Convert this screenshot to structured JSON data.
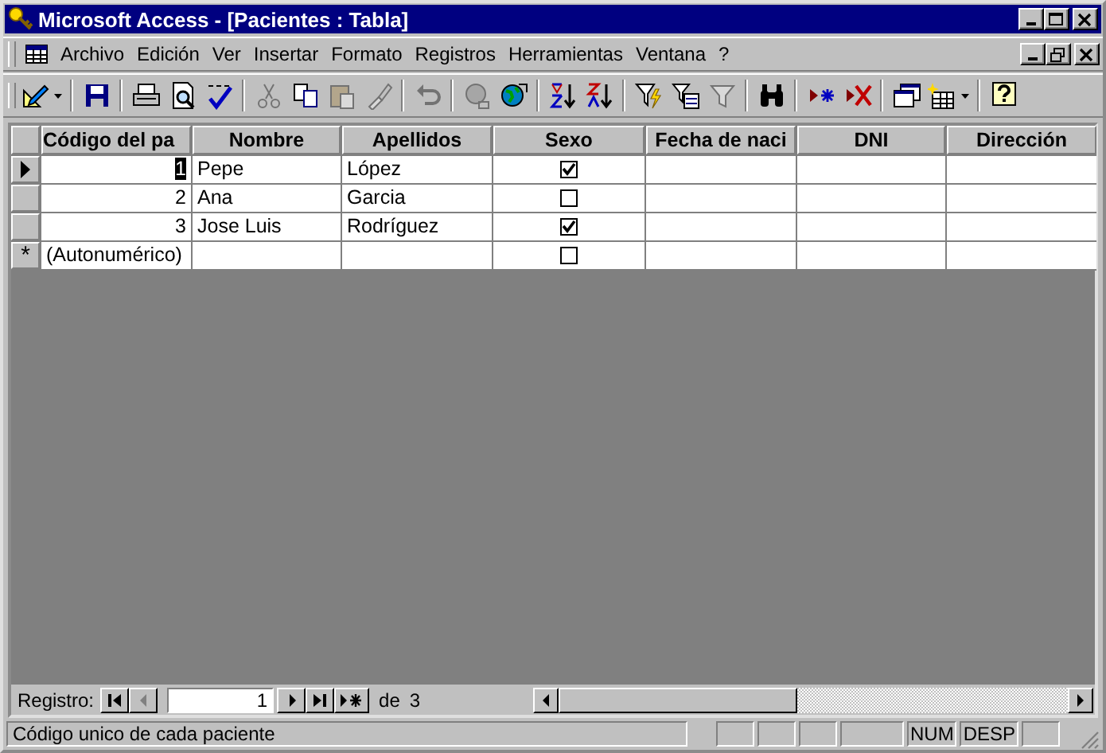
{
  "window": {
    "title": "Microsoft Access - [Pacientes : Tabla]"
  },
  "menu": [
    "Archivo",
    "Edición",
    "Ver",
    "Insertar",
    "Formato",
    "Registros",
    "Herramientas",
    "Ventana",
    "?"
  ],
  "toolbar": [
    {
      "kind": "design",
      "disabled": false,
      "dropdown": true
    },
    {
      "kind": "sep"
    },
    {
      "kind": "save",
      "disabled": false
    },
    {
      "kind": "sep"
    },
    {
      "kind": "print",
      "disabled": false
    },
    {
      "kind": "preview",
      "disabled": false
    },
    {
      "kind": "spelling",
      "disabled": false
    },
    {
      "kind": "sep"
    },
    {
      "kind": "cut",
      "disabled": true
    },
    {
      "kind": "copy",
      "disabled": false
    },
    {
      "kind": "paste",
      "disabled": true
    },
    {
      "kind": "brush",
      "disabled": true
    },
    {
      "kind": "sep"
    },
    {
      "kind": "undo",
      "disabled": true
    },
    {
      "kind": "sep"
    },
    {
      "kind": "globe-link",
      "disabled": true
    },
    {
      "kind": "globe",
      "disabled": false
    },
    {
      "kind": "sep"
    },
    {
      "kind": "sort-asc",
      "disabled": false
    },
    {
      "kind": "sort-desc",
      "disabled": false
    },
    {
      "kind": "sep"
    },
    {
      "kind": "filter-selection",
      "disabled": false
    },
    {
      "kind": "filter-form",
      "disabled": false
    },
    {
      "kind": "filter",
      "disabled": true
    },
    {
      "kind": "sep"
    },
    {
      "kind": "find",
      "disabled": false
    },
    {
      "kind": "sep"
    },
    {
      "kind": "new-record",
      "disabled": false
    },
    {
      "kind": "delete-record",
      "disabled": false
    },
    {
      "kind": "sep"
    },
    {
      "kind": "database",
      "disabled": false
    },
    {
      "kind": "new-object",
      "disabled": false,
      "dropdown": true
    },
    {
      "kind": "sep"
    },
    {
      "kind": "help",
      "disabled": false
    }
  ],
  "table": {
    "columns": [
      "Código del pa",
      "Nombre",
      "Apellidos",
      "Sexo",
      "Fecha de naci",
      "DNI",
      "Dirección"
    ],
    "rows": [
      {
        "kind": "record",
        "current": true,
        "cells": [
          "1",
          "Pepe",
          "López"
        ],
        "sexo": true
      },
      {
        "kind": "record",
        "current": false,
        "cells": [
          "2",
          "Ana",
          "Garcia"
        ],
        "sexo": false
      },
      {
        "kind": "record",
        "current": false,
        "cells": [
          "3",
          "Jose Luis",
          "Rodríguez"
        ],
        "sexo": true
      },
      {
        "kind": "new",
        "current": false,
        "marker": "*",
        "cells": [
          "(Autonumérico)",
          "",
          ""
        ],
        "sexo": false
      }
    ]
  },
  "navigator": {
    "label": "Registro:",
    "value": "1",
    "of": "de",
    "total": "3"
  },
  "status_bar": {
    "text": "Código unico de cada paciente",
    "indicators": [
      "NUM",
      "DESP"
    ]
  }
}
